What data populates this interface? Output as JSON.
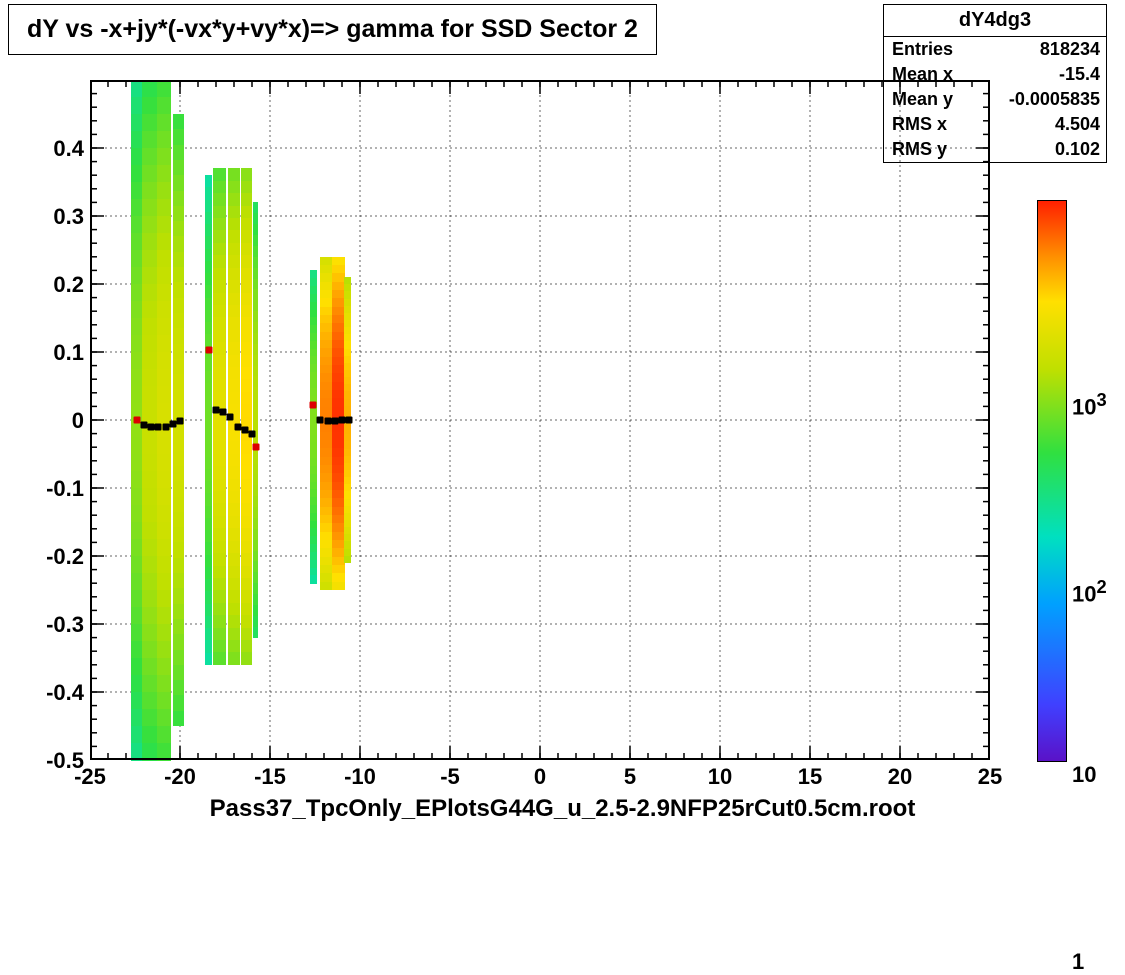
{
  "title": "dY vs -x+jy*(-vx*y+vy*x)=> gamma for SSD Sector 2",
  "stats": {
    "name": "dY4dg3",
    "rows": [
      {
        "label": "Entries",
        "value": "818234"
      },
      {
        "label": "Mean x",
        "value": "-15.4"
      },
      {
        "label": "Mean y",
        "value": "-0.0005835"
      },
      {
        "label": "RMS x",
        "value": "4.504"
      },
      {
        "label": "RMS y",
        "value": "0.102"
      }
    ]
  },
  "caption": "Pass37_TpcOnly_EPlotsG44G_u_2.5-2.9NFP25rCut0.5cm.root",
  "chart_data": {
    "type": "heatmap",
    "title": "dY vs -x+jy*(-vx*y+vy*x)=> gamma for SSD Sector 2",
    "xlabel": "",
    "ylabel": "",
    "xlim": [
      -25,
      25
    ],
    "ylim": [
      -0.5,
      0.5
    ],
    "zscale": "log",
    "zlim": [
      1,
      1000
    ],
    "x_ticks": [
      -25,
      -20,
      -15,
      -10,
      -5,
      0,
      5,
      10,
      15,
      20,
      25
    ],
    "y_ticks": [
      -0.5,
      -0.4,
      -0.3,
      -0.2,
      -0.1,
      0,
      0.1,
      0.2,
      0.3,
      0.4
    ],
    "z_ticks": [
      1,
      10,
      100,
      1000
    ],
    "z_tick_labels": [
      "1",
      "10",
      "10^2",
      "10^3"
    ],
    "bands": [
      {
        "x_center": -22.4,
        "width": 0.6,
        "y_extent": [
          -0.5,
          0.5
        ],
        "peak_z": 90
      },
      {
        "x_center": -21.7,
        "width": 0.8,
        "y_extent": [
          -0.5,
          0.5
        ],
        "peak_z": 140
      },
      {
        "x_center": -20.9,
        "width": 0.8,
        "y_extent": [
          -0.5,
          0.5
        ],
        "peak_z": 170
      },
      {
        "x_center": -20.1,
        "width": 0.6,
        "y_extent": [
          -0.45,
          0.45
        ],
        "peak_z": 160
      },
      {
        "x_center": -18.4,
        "width": 0.4,
        "y_extent": [
          -0.36,
          0.36
        ],
        "peak_z": 70
      },
      {
        "x_center": -17.8,
        "width": 0.7,
        "y_extent": [
          -0.36,
          0.37
        ],
        "peak_z": 200
      },
      {
        "x_center": -17.0,
        "width": 0.7,
        "y_extent": [
          -0.36,
          0.37
        ],
        "peak_z": 260
      },
      {
        "x_center": -16.3,
        "width": 0.6,
        "y_extent": [
          -0.36,
          0.37
        ],
        "peak_z": 300
      },
      {
        "x_center": -15.8,
        "width": 0.3,
        "y_extent": [
          -0.32,
          0.32
        ],
        "peak_z": 120
      },
      {
        "x_center": -12.6,
        "width": 0.4,
        "y_extent": [
          -0.24,
          0.22
        ],
        "peak_z": 80
      },
      {
        "x_center": -11.9,
        "width": 0.7,
        "y_extent": [
          -0.25,
          0.24
        ],
        "peak_z": 550
      },
      {
        "x_center": -11.2,
        "width": 0.7,
        "y_extent": [
          -0.25,
          0.24
        ],
        "peak_z": 900
      },
      {
        "x_center": -10.7,
        "width": 0.4,
        "y_extent": [
          -0.21,
          0.21
        ],
        "peak_z": 400
      }
    ],
    "profile_points": [
      {
        "x": -22.4,
        "y": 0.0,
        "color": "red"
      },
      {
        "x": -22.0,
        "y": -0.008
      },
      {
        "x": -21.6,
        "y": -0.01
      },
      {
        "x": -21.2,
        "y": -0.01
      },
      {
        "x": -20.8,
        "y": -0.01
      },
      {
        "x": -20.4,
        "y": -0.006
      },
      {
        "x": -20.0,
        "y": -0.002
      },
      {
        "x": -18.4,
        "y": 0.103,
        "color": "red"
      },
      {
        "x": -18.0,
        "y": 0.015
      },
      {
        "x": -17.6,
        "y": 0.012
      },
      {
        "x": -17.2,
        "y": 0.004
      },
      {
        "x": -16.8,
        "y": -0.01
      },
      {
        "x": -16.4,
        "y": -0.015
      },
      {
        "x": -16.0,
        "y": -0.02
      },
      {
        "x": -15.8,
        "y": -0.04,
        "color": "red"
      },
      {
        "x": -12.6,
        "y": 0.022,
        "color": "red"
      },
      {
        "x": -12.2,
        "y": 0.0
      },
      {
        "x": -11.8,
        "y": -0.002
      },
      {
        "x": -11.4,
        "y": -0.002
      },
      {
        "x": -11.0,
        "y": 0.0
      },
      {
        "x": -10.6,
        "y": 0.0
      }
    ],
    "colorbar_gradient": [
      {
        "t": 0.0,
        "c": "#5a12c8"
      },
      {
        "t": 0.1,
        "c": "#4040ff"
      },
      {
        "t": 0.28,
        "c": "#00a0ff"
      },
      {
        "t": 0.4,
        "c": "#00e0c0"
      },
      {
        "t": 0.55,
        "c": "#30e040"
      },
      {
        "t": 0.7,
        "c": "#c0e000"
      },
      {
        "t": 0.82,
        "c": "#ffe000"
      },
      {
        "t": 0.9,
        "c": "#ff9000"
      },
      {
        "t": 1.0,
        "c": "#ff2000"
      }
    ]
  }
}
